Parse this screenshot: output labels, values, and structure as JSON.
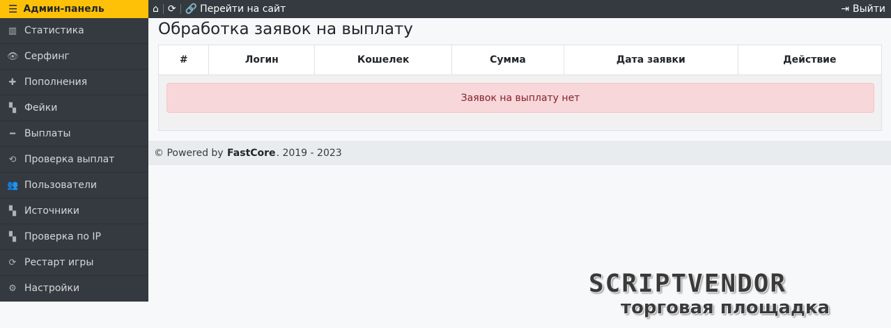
{
  "sidebar": {
    "brand": "Админ-панель",
    "brand_icon": "bars-icon",
    "items": [
      {
        "label": "Статистика",
        "icon": "bar-chart-icon",
        "glyph": "▥"
      },
      {
        "label": "Серфинг",
        "icon": "eye-icon",
        "glyph": "👁"
      },
      {
        "label": "Пополнения",
        "icon": "plus-icon",
        "glyph": "✚"
      },
      {
        "label": "Фейки",
        "icon": "map-icon",
        "glyph": "▚"
      },
      {
        "label": "Выплаты",
        "icon": "minus-icon",
        "glyph": "━"
      },
      {
        "label": "Проверка выплат",
        "icon": "history-icon",
        "glyph": "⟲"
      },
      {
        "label": "Пользователи",
        "icon": "users-icon",
        "glyph": "👥"
      },
      {
        "label": "Источники",
        "icon": "map-icon",
        "glyph": "▚"
      },
      {
        "label": "Проверка по IP",
        "icon": "map-icon",
        "glyph": "▚"
      },
      {
        "label": "Рестарт игры",
        "icon": "refresh-icon",
        "glyph": "⟳"
      },
      {
        "label": "Настройки",
        "icon": "gear-icon",
        "glyph": "⚙"
      }
    ]
  },
  "topbar": {
    "go_to_site": "Перейти на сайт",
    "logout": "Выйти"
  },
  "main": {
    "title": "Обработка заявок на выплату",
    "table": {
      "columns": [
        "#",
        "Логин",
        "Кошелек",
        "Сумма",
        "Дата заявки",
        "Действие"
      ]
    },
    "empty_message": "Заявок на выплату нет"
  },
  "footer": {
    "prefix": "© Powered by",
    "brand": "FastCore",
    "suffix": ". 2019 - 2023"
  },
  "watermark": {
    "line1": "SCRIPTVENDOR",
    "line2": "торговая площадка"
  }
}
